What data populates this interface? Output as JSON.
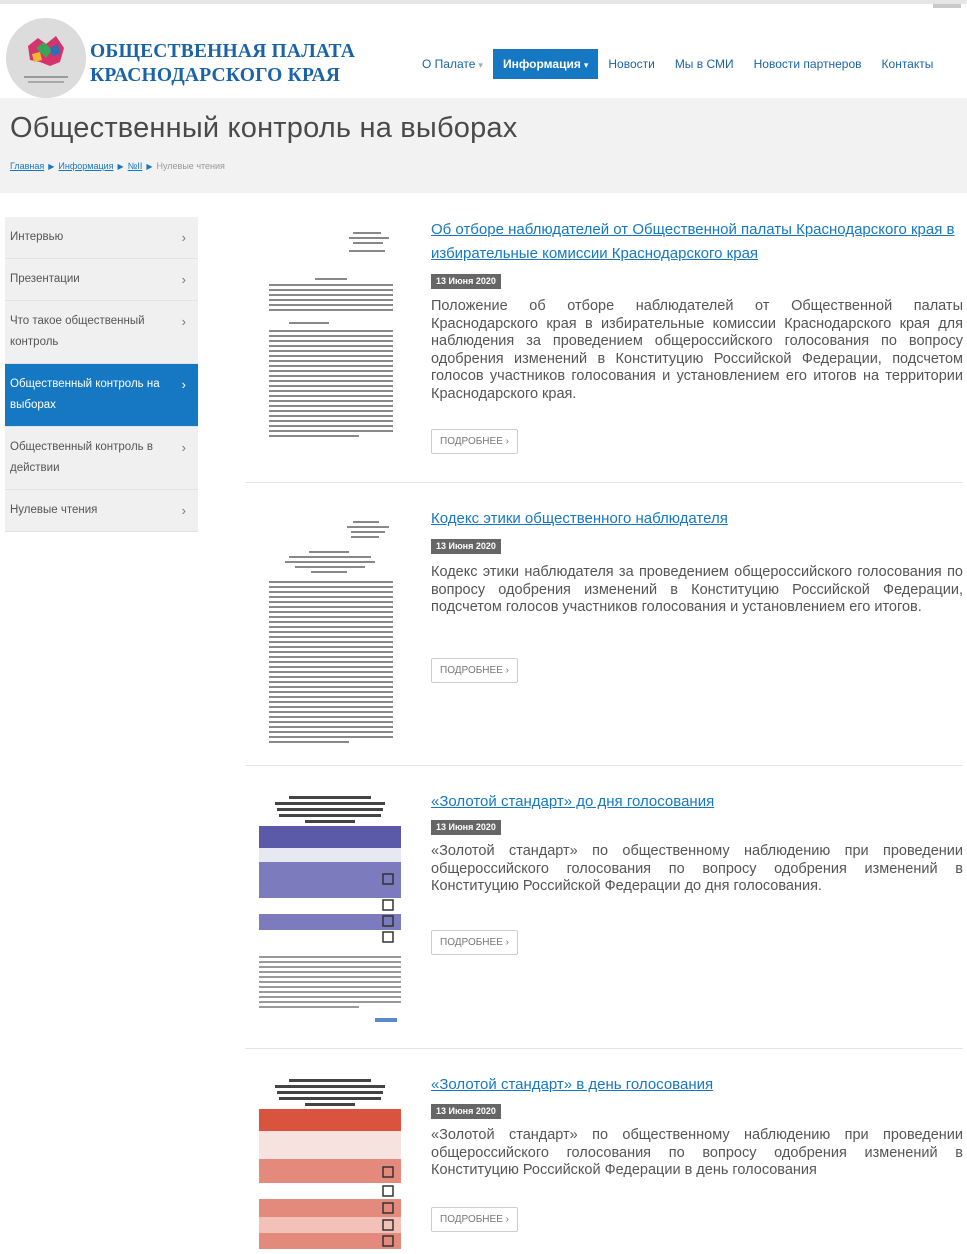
{
  "header": {
    "org_line1": "ОБЩЕСТВЕННАЯ ПАЛАТА",
    "org_line2": "КРАСНОДАРСКОГО КРАЯ",
    "nav": [
      {
        "label": "О Палате",
        "has_caret": true
      },
      {
        "label": "Информация",
        "has_caret": true,
        "active": true
      },
      {
        "label": "Новости"
      },
      {
        "label": "Мы в СМИ"
      },
      {
        "label": "Новости партнеров"
      },
      {
        "label": "Контакты"
      }
    ]
  },
  "page": {
    "title": "Общественный контроль на выборах",
    "breadcrumb": [
      "Главная",
      "Информация",
      "№II",
      "Нулевые чтения"
    ]
  },
  "sidebar": {
    "items": [
      {
        "label": "Интервью"
      },
      {
        "label": "Презентации"
      },
      {
        "label": "Что такое общественный контроль"
      },
      {
        "label": "Общественный контроль на выборах",
        "active": true
      },
      {
        "label": "Общественный контроль в действии"
      },
      {
        "label": "Нулевые чтения"
      }
    ]
  },
  "articles": [
    {
      "title": "Об отборе наблюдателей от Общественной палаты Краснодарского края в избирательные комиссии Краснодарского края",
      "date": "13 Июня 2020",
      "text": "Положение об отборе наблюдателей от Общественной палаты Краснодарского края в избирательные комиссии Краснодарского края для наблюдения за проведением общероссийского голосования по вопросу одобрения изменений в Конституцию Российской Федерации, подсчетом голосов участников голосования и установлением его итогов на территории Краснодарского края.",
      "more": "ПОДРОБНЕЕ ›"
    },
    {
      "title": "Кодекс этики общественного наблюдателя",
      "date": "13 Июня 2020",
      "text": "Кодекс этики наблюдателя за проведением общероссийского голосования по вопросу одобрения изменений в Конституцию Российской Федерации, подсчетом голосов участников голосования и установлением его итогов.",
      "more": "ПОДРОБНЕЕ ›"
    },
    {
      "title": "«Золотой стандарт» до дня голосования",
      "date": "13 Июня 2020",
      "text": "«Золотой стандарт» по общественному наблюдению при проведении общероссийского голосования по вопросу одобрения изменений в Конституцию Российской Федерации до дня голосования.",
      "more": "ПОДРОБНЕЕ ›"
    },
    {
      "title": "«Золотой стандарт» в день голосования",
      "date": "13 Июня 2020",
      "text": "«Золотой стандарт» по общественному наблюдению при проведении общероссийского голосования по вопросу одобрения изменений в Конституцию Российской Федерации в день голосования",
      "more": "ПОДРОБНЕЕ ›"
    }
  ],
  "colors": {
    "accent": "#1678c2",
    "title_band": "#f2f2f2",
    "sidebar_bg": "#f0f0f0",
    "date_badge": "#666666",
    "thumb_blue": "#5a5aa8",
    "thumb_red": "#d9533f"
  }
}
